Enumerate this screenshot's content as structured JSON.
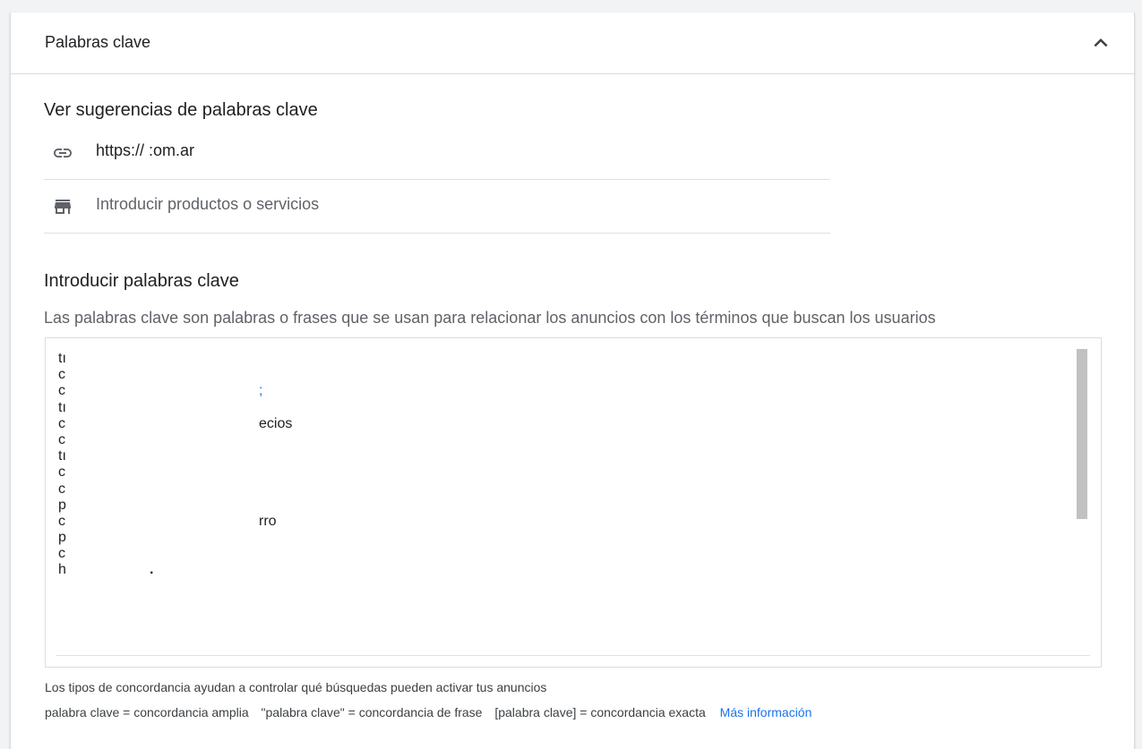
{
  "header": {
    "title": "Palabras clave",
    "collapse_icon": "chevron-up-icon"
  },
  "suggestions": {
    "title": "Ver sugerencias de palabras clave",
    "url": {
      "icon": "link-icon",
      "value": "https://                              :om.ar"
    },
    "products": {
      "icon": "store-icon",
      "placeholder": "Introducir productos o servicios"
    }
  },
  "keywords": {
    "title": "Introducir palabras clave",
    "description": "Las palabras clave son palabras o frases que se usan para relacionar los anuncios con los términos que buscan los usuarios",
    "lines": [
      {
        "start": "tı",
        "end": ""
      },
      {
        "start": "c",
        "end": ""
      },
      {
        "start": "c",
        "end": ";"
      },
      {
        "start": "tı",
        "end": ""
      },
      {
        "start": "c",
        "end": "ecios"
      },
      {
        "start": "c",
        "end": ""
      },
      {
        "start": "tı",
        "end": ""
      },
      {
        "start": "c",
        "end": ""
      },
      {
        "start": "c",
        "end": ""
      },
      {
        "start": "p",
        "end": ""
      },
      {
        "start": "c",
        "end": "rro"
      },
      {
        "start": "p",
        "end": ""
      },
      {
        "start": "c",
        "end": ""
      },
      {
        "start": "h",
        "end": "."
      }
    ]
  },
  "match_types": {
    "line1": "Los tipos de concordancia ayudan a controlar qué búsquedas pueden activar tus anuncios",
    "broad": "palabra clave = concordancia amplia",
    "phrase": "\"palabra clave\" = concordancia de frase",
    "exact": "[palabra clave] = concordancia exacta",
    "link": "Más información"
  },
  "colors": {
    "accent": "#1a73e8",
    "text": "#202124",
    "secondary": "#5f6368",
    "divider": "#dadce0"
  }
}
